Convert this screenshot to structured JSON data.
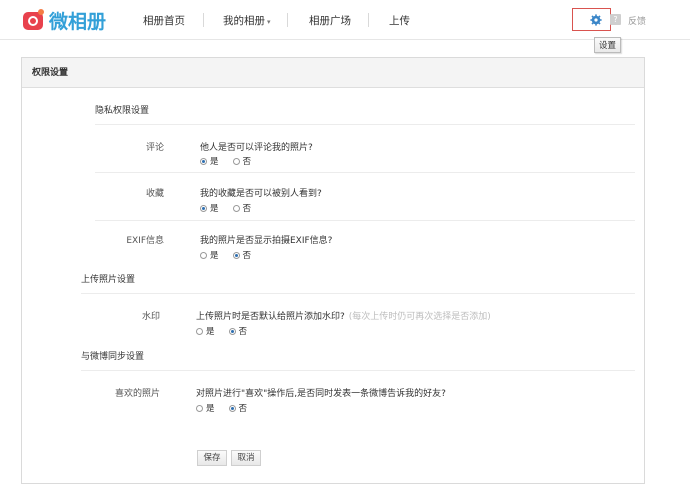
{
  "brand": {
    "name": "微相册",
    "accent": "#33a0d8",
    "logo_color": "#e8424d"
  },
  "nav": {
    "items": [
      "相册首页",
      "我的相册",
      "相册广场",
      "上传"
    ]
  },
  "header": {
    "feedback": "反馈",
    "tooltip": "设置",
    "help_glyph": "?"
  },
  "panel": {
    "title": "权限设置"
  },
  "sections": {
    "privacy": {
      "title": "隐私权限设置",
      "rows": [
        {
          "label": "评论",
          "question": "他人是否可以评论我的照片?",
          "yes": "是",
          "no": "否",
          "selected": "yes"
        },
        {
          "label": "收藏",
          "question": "我的收藏是否可以被别人看到?",
          "yes": "是",
          "no": "否",
          "selected": "yes"
        },
        {
          "label": "EXIF信息",
          "question": "我的照片是否显示拍摄EXIF信息?",
          "yes": "是",
          "no": "否",
          "selected": "no"
        }
      ]
    },
    "upload": {
      "title": "上传照片设置",
      "rows": [
        {
          "label": "水印",
          "question": "上传照片时是否默认给照片添加水印?",
          "hint": "(每次上传时仍可再次选择是否添加)",
          "yes": "是",
          "no": "否",
          "selected": "no"
        }
      ]
    },
    "weibo": {
      "title": "与微博同步设置",
      "rows": [
        {
          "label": "喜欢的照片",
          "question": "对照片进行\"喜欢\"操作后,是否同时发表一条微博告诉我的好友?",
          "yes": "是",
          "no": "否",
          "selected": "no"
        }
      ]
    }
  },
  "buttons": {
    "save": "保存",
    "cancel": "取消"
  }
}
